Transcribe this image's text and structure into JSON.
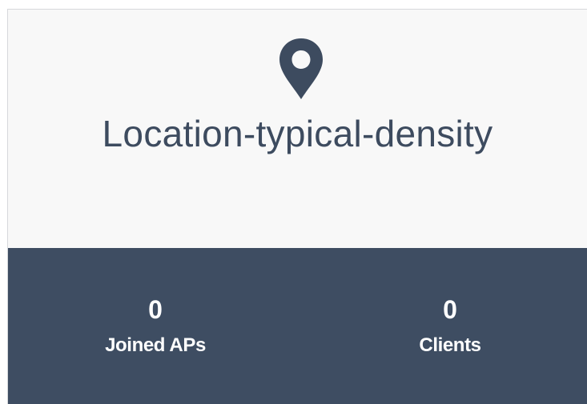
{
  "location": {
    "name": "Location-typical-density",
    "icon": "map-pin-icon"
  },
  "stats": {
    "joined_aps": {
      "value": "0",
      "label": "Joined APs"
    },
    "clients": {
      "value": "0",
      "label": "Clients"
    }
  },
  "colors": {
    "card_background": "#f8f8f8",
    "primary_text": "#3d4b5f",
    "stats_background": "#3e4d62",
    "stats_text": "#ffffff"
  }
}
